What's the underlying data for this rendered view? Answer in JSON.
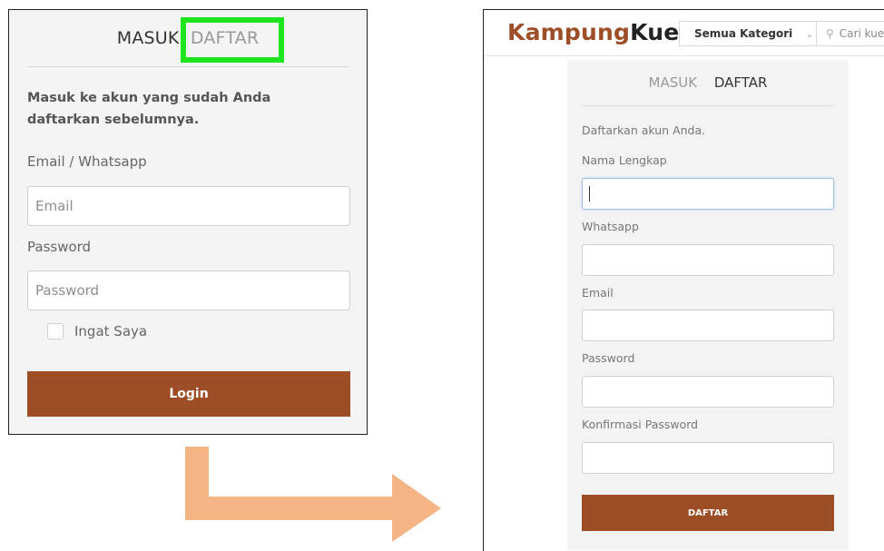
{
  "login": {
    "tab_masuk": "MASUK",
    "tab_daftar": "DAFTAR",
    "heading": "Masuk ke akun yang sudah Anda daftarkan sebelumnya.",
    "email_label": "Email / Whatsapp",
    "email_placeholder": "Email",
    "password_label": "Password",
    "password_placeholder": "Password",
    "remember_label": "Ingat Saya",
    "remember_checked": false,
    "login_button": "Login"
  },
  "header": {
    "brand_part1": "Kampung",
    "brand_part2": "Kue",
    "category_select": "Semua Kategori",
    "search_placeholder": "Cari kue"
  },
  "register": {
    "tab_masuk": "MASUK",
    "tab_daftar": "DAFTAR",
    "intro": "Daftarkan akun Anda.",
    "fields": [
      {
        "label": "Nama Lengkap",
        "value": ""
      },
      {
        "label": "Whatsapp",
        "value": ""
      },
      {
        "label": "Email",
        "value": ""
      },
      {
        "label": "Password",
        "value": ""
      },
      {
        "label": "Konfirmasi Password",
        "value": ""
      }
    ],
    "submit_button": "DAFTAR"
  },
  "colors": {
    "brand_brown": "#9e4e27",
    "highlight_green": "#1fe51f",
    "arrow_orange": "#f4b483"
  }
}
